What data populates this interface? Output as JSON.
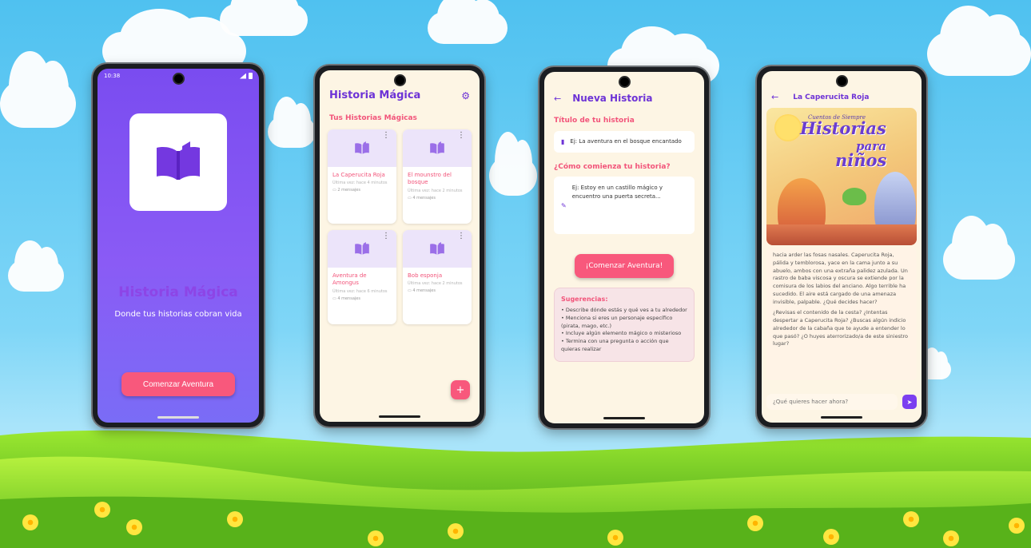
{
  "colors": {
    "primary": "#6d33d6",
    "accent": "#f8587c",
    "cream": "#fdf5e4",
    "splash": "#7a4cf0"
  },
  "splash": {
    "status_time": "10:38",
    "app_icon": "open-book-icon",
    "title": "Historia Mágica",
    "subtitle": "Donde tus historias cobran vida",
    "button": "Comenzar Aventura"
  },
  "library": {
    "title": "Historia Mágica",
    "settings_icon": "gear-icon",
    "section": "Tus Historias Mágicas",
    "stories": [
      {
        "title": "La Caperucita Roja",
        "meta": "Última vez: hace 4 minutos",
        "count": "2 mensajes"
      },
      {
        "title": "El mounstro del bosque",
        "meta": "Última vez: hace 2 minutos",
        "count": "4 mensajes"
      },
      {
        "title": "Aventura de Amongus",
        "meta": "Última vez: hace 6 minutos",
        "count": "4 mensajes"
      },
      {
        "title": "Bob esponja",
        "meta": "Última vez: hace 2 minutos",
        "count": "4 mensajes"
      }
    ],
    "fab": "+"
  },
  "new_story": {
    "title": "Nueva Historia",
    "title_label": "Título de tu historia",
    "title_placeholder": "Ej: La aventura en el bosque encantado",
    "start_label": "¿Cómo comienza tu historia?",
    "start_placeholder": "Ej: Estoy en un castillo mágico y encuentro una puerta secreta...",
    "button": "¡Comenzar Aventura!",
    "suggestions_title": "Sugerencias:",
    "suggestions": [
      "• Describe dónde estás y qué ves a tu alrededor",
      "• Menciona si eres un personaje específico (pirata, mago, etc.)",
      "• Incluye algún elemento mágico o misterioso",
      "• Termina con una pregunta o acción que quieras realizar"
    ]
  },
  "chat": {
    "title": "La Caperucita Roja",
    "cover_small": "Cuentos de Siempre",
    "cover_big_1": "Historias",
    "cover_big_2": "para",
    "cover_big_3": "niños",
    "paragraph_1": "hacia arder las fosas nasales. Caperucita Roja, pálida y temblorosa, yace en la cama junto a su abuelo, ambos con una extraña palidez azulada. Un rastro de baba viscosa y oscura se extiende por la comisura de los labios del anciano. Algo terrible ha sucedido. El aire está cargado de una amenaza invisible, palpable. ¿Qué decides hacer?",
    "paragraph_2": "¿Revisas el contenido de la cesta? ¿Intentas despertar a Caperucita Roja? ¿Buscas algún indicio alrededor de la cabaña que te ayude a entender lo que pasó? ¿O huyes aterrorizado/a de este siniestro lugar?",
    "input_placeholder": "¿Qué quieres hacer ahora?"
  }
}
